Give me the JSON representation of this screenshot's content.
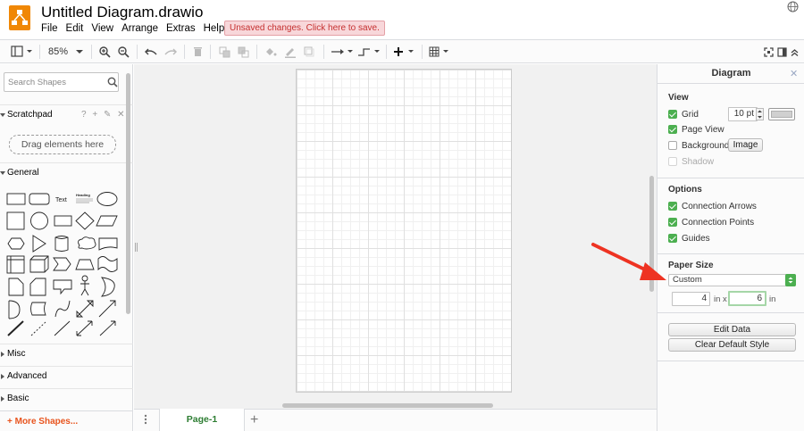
{
  "app": {
    "title": "Untitled Diagram.drawio",
    "unsaved_notice": "Unsaved changes. Click here to save."
  },
  "menu": [
    "File",
    "Edit",
    "View",
    "Arrange",
    "Extras",
    "Help"
  ],
  "toolbar": {
    "zoom": "85%"
  },
  "sidebar": {
    "search_placeholder": "Search Shapes",
    "scratchpad": {
      "label": "Scratchpad",
      "tools": "? + ✎ ✕",
      "dropzone": "Drag elements here"
    },
    "general_label": "General",
    "text_shape_label": "Text",
    "heading_shape_label": "Heading",
    "sections": [
      "Misc",
      "Advanced",
      "Basic"
    ],
    "more_shapes": "+ More Shapes..."
  },
  "pages": {
    "active": "Page-1",
    "add": "+"
  },
  "panel": {
    "title": "Diagram",
    "close": "✕",
    "view": {
      "title": "View",
      "grid_label": "Grid",
      "grid_size": "10 pt",
      "page_view_label": "Page View",
      "background_label": "Background",
      "image_button": "Image",
      "shadow_label": "Shadow"
    },
    "options": {
      "title": "Options",
      "connection_arrows": "Connection Arrows",
      "connection_points": "Connection Points",
      "guides": "Guides"
    },
    "paper": {
      "title": "Paper Size",
      "selected": "Custom",
      "width": "4",
      "width_unit": "in x",
      "height": "6",
      "height_unit": "in"
    },
    "actions": {
      "edit_data": "Edit Data",
      "clear_style": "Clear Default Style"
    }
  },
  "colors": {
    "accent_green": "#4caf50",
    "brand_orange": "#f08705",
    "more_shapes": "#e8541e",
    "annotation_red": "#ee3322"
  }
}
